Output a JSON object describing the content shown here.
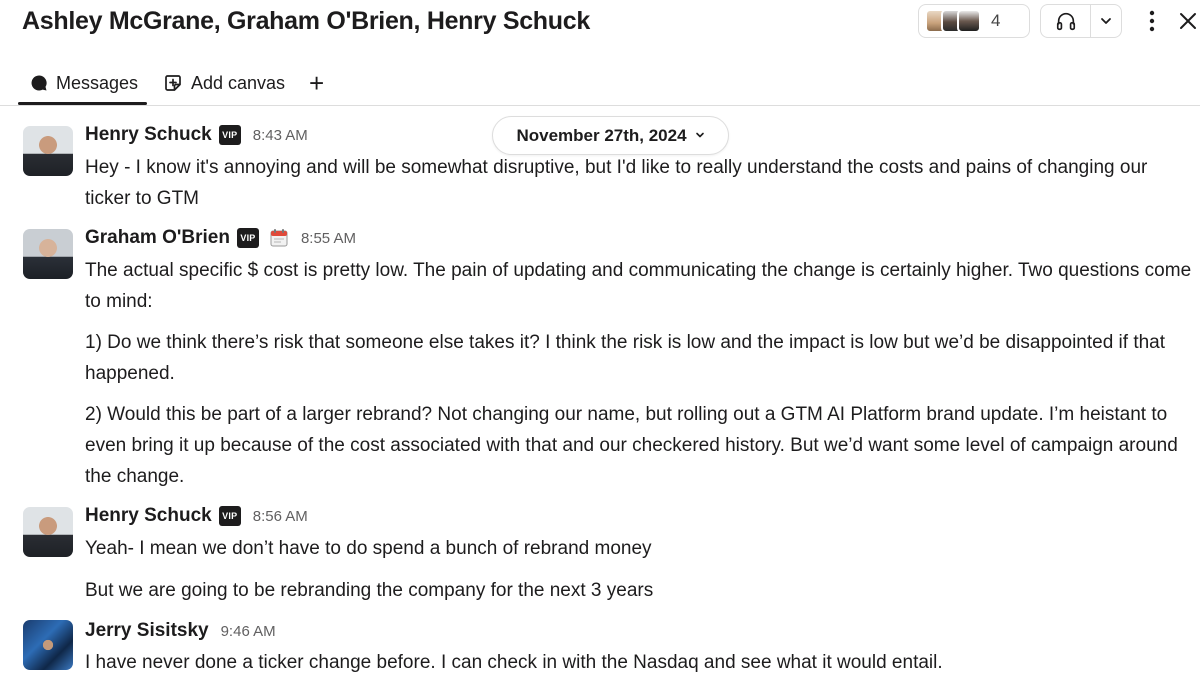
{
  "header": {
    "title": "Ashley McGrane, Graham O'Brien, Henry Schuck",
    "member_count": "4",
    "icons": [
      "member-avatars",
      "headphones-icon",
      "chevron-down-icon",
      "more-vertical-icon",
      "close-icon"
    ]
  },
  "tabs": [
    {
      "label": "Messages",
      "icon": "message-bubble-icon",
      "active": true
    },
    {
      "label": "Add canvas",
      "icon": "canvas-icon",
      "active": false
    },
    {
      "label": "+",
      "icon": "plus-icon",
      "active": false
    }
  ],
  "date_divider": {
    "label": "November 27th, 2024"
  },
  "messages": [
    {
      "author": "Henry Schuck",
      "badge": "VIP",
      "time": "8:43 AM",
      "paragraphs": [
        "Hey - I know it's annoying and will be somewhat disruptive, but I'd like to really understand the costs and pains of changing our ticker to GTM"
      ]
    },
    {
      "author": "Graham O'Brien",
      "badge": "VIP",
      "status_emoji": "calendar-icon",
      "time": "8:55 AM",
      "paragraphs": [
        "The actual specific $ cost is pretty low. The pain of updating and communicating the change is certainly higher. Two questions come to mind:",
        "1) Do we think there’s risk that someone else takes it? I think the risk is low and the impact is low but we’d be disappointed if that happened.",
        "2) Would this be part of a larger rebrand? Not changing our name, but rolling out a GTM AI Platform brand update. I’m heistant to even bring it up because of the cost associated with that and our checkered history. But we’d want some level of campaign around the change."
      ]
    },
    {
      "author": "Henry Schuck",
      "badge": "VIP",
      "time": "8:56 AM",
      "paragraphs": [
        "Yeah- I mean we don’t have to do spend a bunch of rebrand money",
        "But we are going to be rebranding the company for the next 3 years"
      ]
    },
    {
      "author": "Jerry Sisitsky",
      "time": "9:46 AM",
      "paragraphs": [
        "I have never done a ticker change before. I can check in with the Nasdaq and see what it would entail."
      ]
    }
  ],
  "colors": {
    "text": "#1d1c1d",
    "muted": "#616061",
    "border": "#dddddd",
    "badge": "#1d1c1d"
  }
}
